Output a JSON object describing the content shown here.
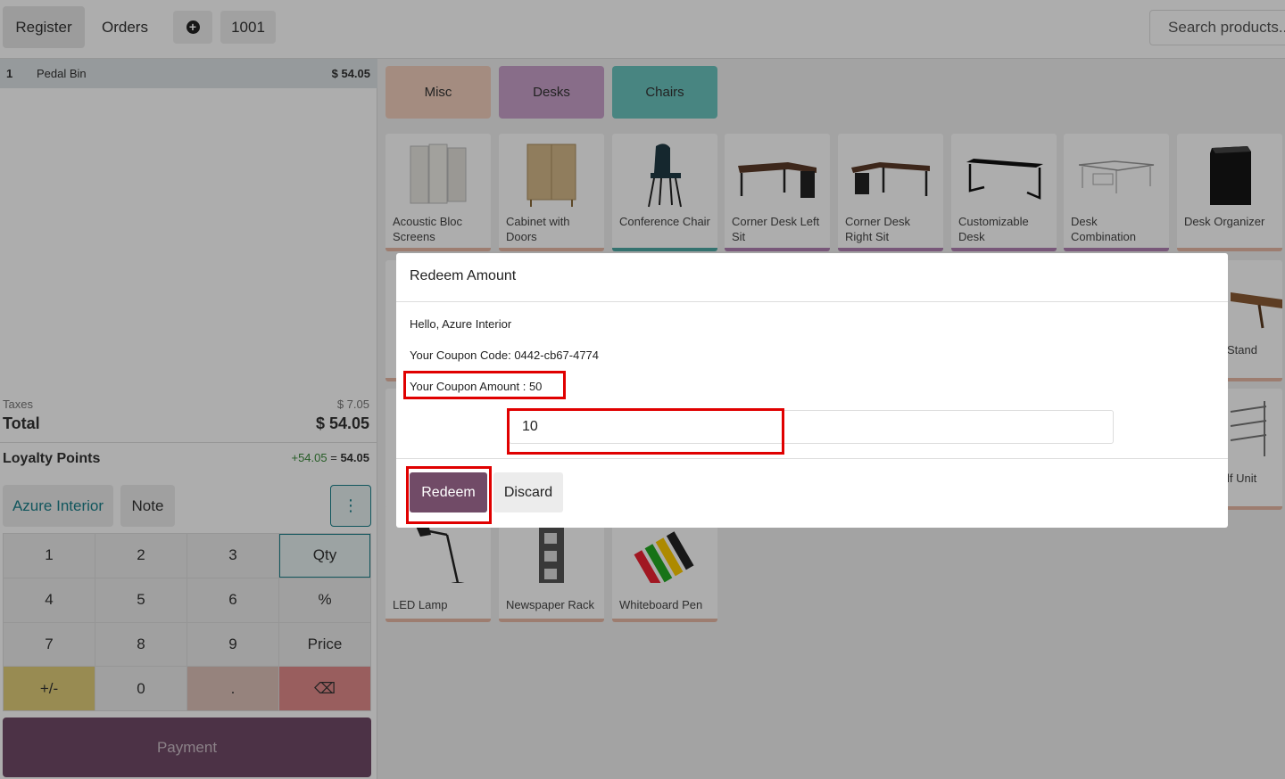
{
  "topbar": {
    "register_label": "Register",
    "orders_label": "Orders",
    "order_number": "1001",
    "search_placeholder": "Search products..."
  },
  "order": {
    "lines": [
      {
        "qty": "1",
        "product": "Pedal Bin",
        "price": "$ 54.05"
      }
    ],
    "taxes_label": "Taxes",
    "taxes_value": "$ 7.05",
    "total_label": "Total",
    "total_value": "$ 54.05",
    "loyalty_label": "Loyalty Points",
    "loyalty_gain": "+54.05",
    "loyalty_eq": "=",
    "loyalty_total": "54.05"
  },
  "actions": {
    "customer_label": "Azure Interior",
    "note_label": "Note",
    "more_icon": "⋮"
  },
  "numpad": {
    "keys": [
      "1",
      "2",
      "3",
      "Qty",
      "4",
      "5",
      "6",
      "%",
      "7",
      "8",
      "9",
      "Price",
      "+/-",
      "0",
      ".",
      "⌫"
    ]
  },
  "payment_label": "Payment",
  "categories": [
    "Misc",
    "Desks",
    "Chairs"
  ],
  "products": [
    {
      "name": "Acoustic Bloc Screens"
    },
    {
      "name": "Cabinet with Doors"
    },
    {
      "name": "Conference Chair"
    },
    {
      "name": "Corner Desk Left Sit"
    },
    {
      "name": "Corner Desk Right Sit"
    },
    {
      "name": "Customizable Desk"
    },
    {
      "name": "Desk Combination"
    },
    {
      "name": "Desk Organizer"
    },
    {
      "name": "LED Lamp"
    },
    {
      "name": "Newspaper Rack"
    },
    {
      "name": "Whiteboard Pen"
    }
  ],
  "partial_products": [
    "Stand",
    "lf Unit"
  ],
  "modal": {
    "title": "Redeem Amount",
    "greeting": "Hello, Azure Interior",
    "coupon_code": "Your Coupon Code: 0442-cb67-4774",
    "coupon_amount": "Your Coupon Amount : 50",
    "input_value": "10",
    "redeem_label": "Redeem",
    "discard_label": "Discard"
  },
  "colors": {
    "primary": "#714b67",
    "teal": "#1a7f8a",
    "highlight": "#e00000"
  }
}
